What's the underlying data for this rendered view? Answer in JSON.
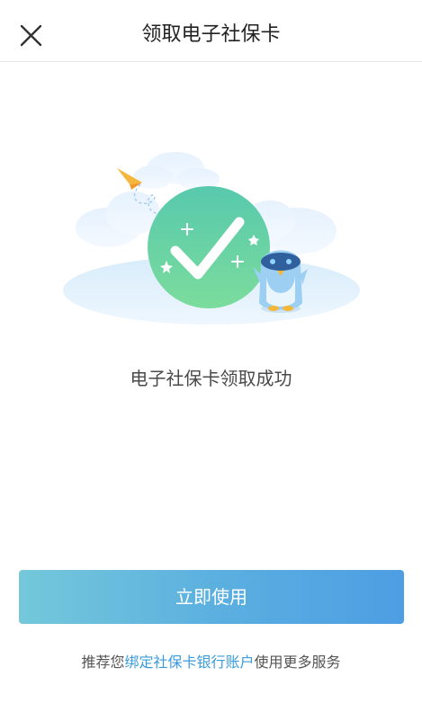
{
  "header": {
    "title": "领取电子社保卡",
    "close_icon": "close-icon"
  },
  "main": {
    "illustration": {
      "icons": [
        "success-check-icon",
        "paper-plane-icon",
        "cloud-icon",
        "mascot-penguin-icon",
        "sparkle-icon"
      ]
    },
    "success_message": "电子社保卡领取成功"
  },
  "actions": {
    "primary_label": "立即使用"
  },
  "footer": {
    "prefix": "推荐您",
    "link_text": "绑定社保卡银行账户",
    "suffix": "使用更多服务"
  },
  "colors": {
    "accent_gradient_start": "#74c8da",
    "accent_gradient_end": "#4d9ee3",
    "success_green": "#5fd0a4",
    "link_blue": "#3a9bdc"
  }
}
